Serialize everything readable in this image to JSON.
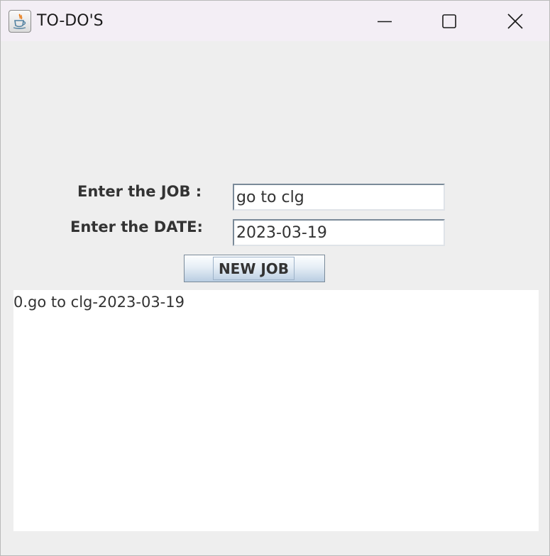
{
  "window": {
    "title": "TO-DO'S",
    "icon": "java-coffee-cup-icon",
    "controls": [
      "minimize-icon",
      "maximize-icon",
      "close-icon"
    ]
  },
  "form": {
    "job_label": "Enter the JOB :",
    "job_value": "go to clg",
    "date_label": "Enter the DATE:",
    "date_value": "2023-03-19",
    "new_job_button": "NEW JOB"
  },
  "output": {
    "lines": [
      "0.go to clg-2023-03-19"
    ]
  },
  "colors": {
    "window_bg": "#eeeeee",
    "titlebar_bg": "#f3eef5",
    "text": "#333333",
    "java_orange": "#e76f00",
    "java_blue": "#5382a1"
  }
}
